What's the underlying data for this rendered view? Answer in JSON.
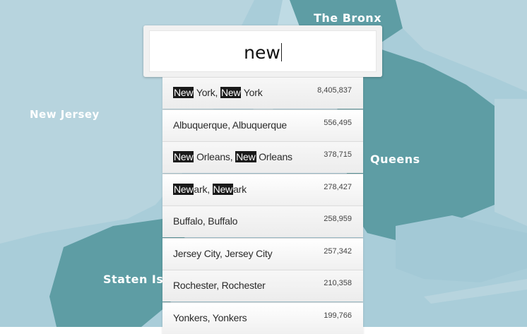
{
  "map": {
    "labels": {
      "bronx": "The Bronx",
      "new_jersey": "New Jersey",
      "queens": "Queens",
      "staten_island": "Staten Isla"
    },
    "colors": {
      "water": "#a9cdd9",
      "land": "#b7d4de",
      "borough": "#5e9da4"
    }
  },
  "search": {
    "value": "new"
  },
  "results": [
    {
      "name": [
        "",
        "New",
        " York, ",
        "New",
        " York"
      ],
      "population": "8,405,837"
    },
    {
      "name": [
        "Albuquerque, Albuquerque"
      ],
      "population": "556,495"
    },
    {
      "name": [
        "",
        "New",
        " Orleans, ",
        "New",
        " Orleans"
      ],
      "population": "378,715"
    },
    {
      "name": [
        "",
        "New",
        "ark, ",
        "New",
        "ark"
      ],
      "population": "278,427"
    },
    {
      "name": [
        "Buffalo, Buffalo"
      ],
      "population": "258,959"
    },
    {
      "name": [
        "Jersey City, Jersey City"
      ],
      "population": "257,342"
    },
    {
      "name": [
        "Rochester, Rochester"
      ],
      "population": "210,358"
    },
    {
      "name": [
        "Yonkers, Yonkers"
      ],
      "population": "199,766"
    }
  ]
}
